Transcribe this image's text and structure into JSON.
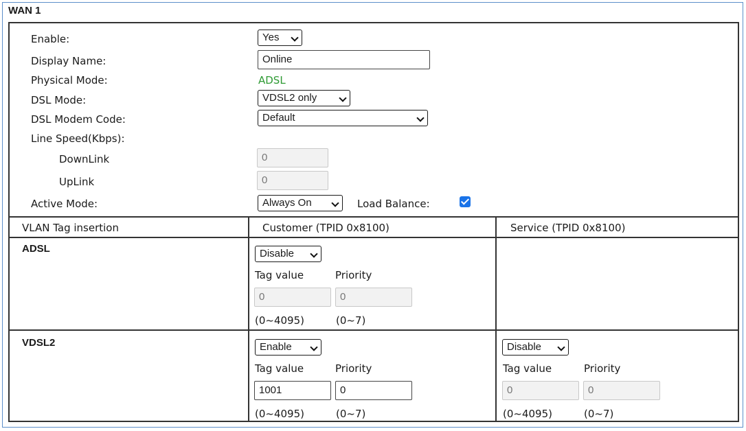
{
  "title": "WAN 1",
  "form": {
    "enable": {
      "label": "Enable:",
      "value": "Yes"
    },
    "display_name": {
      "label": "Display Name:",
      "value": "Online"
    },
    "physical_mode": {
      "label": "Physical Mode:",
      "value": "ADSL"
    },
    "dsl_mode": {
      "label": "DSL Mode:",
      "value": "VDSL2 only"
    },
    "dsl_modem_code": {
      "label": "DSL Modem Code:",
      "value": "Default"
    },
    "line_speed": {
      "label": "Line Speed(Kbps):"
    },
    "downlink": {
      "label": "DownLink",
      "value": "0"
    },
    "uplink": {
      "label": "UpLink",
      "value": "0"
    },
    "active_mode": {
      "label": "Active Mode:",
      "value": "Always On"
    },
    "load_balance": {
      "label": "Load Balance:",
      "checked": true
    }
  },
  "vlan": {
    "headers": [
      "VLAN Tag insertion",
      "Customer (TPID 0x8100)",
      "Service (TPID 0x8100)"
    ],
    "tag_value_label": "Tag value",
    "priority_label": "Priority",
    "tag_range": "(0~4095)",
    "priority_range": "(0~7)",
    "adsl": {
      "name": "ADSL",
      "customer": {
        "state": "Disable",
        "tag_value": "0",
        "priority": "0"
      }
    },
    "vdsl2": {
      "name": "VDSL2",
      "customer": {
        "state": "Enable",
        "tag_value": "1001",
        "priority": "0"
      },
      "service": {
        "state": "Disable",
        "tag_value": "0",
        "priority": "0"
      }
    }
  },
  "colors": {
    "frame": "#5b8ec9",
    "physical_mode_value": "#2e9a33",
    "checkbox": "#1a73e8"
  }
}
